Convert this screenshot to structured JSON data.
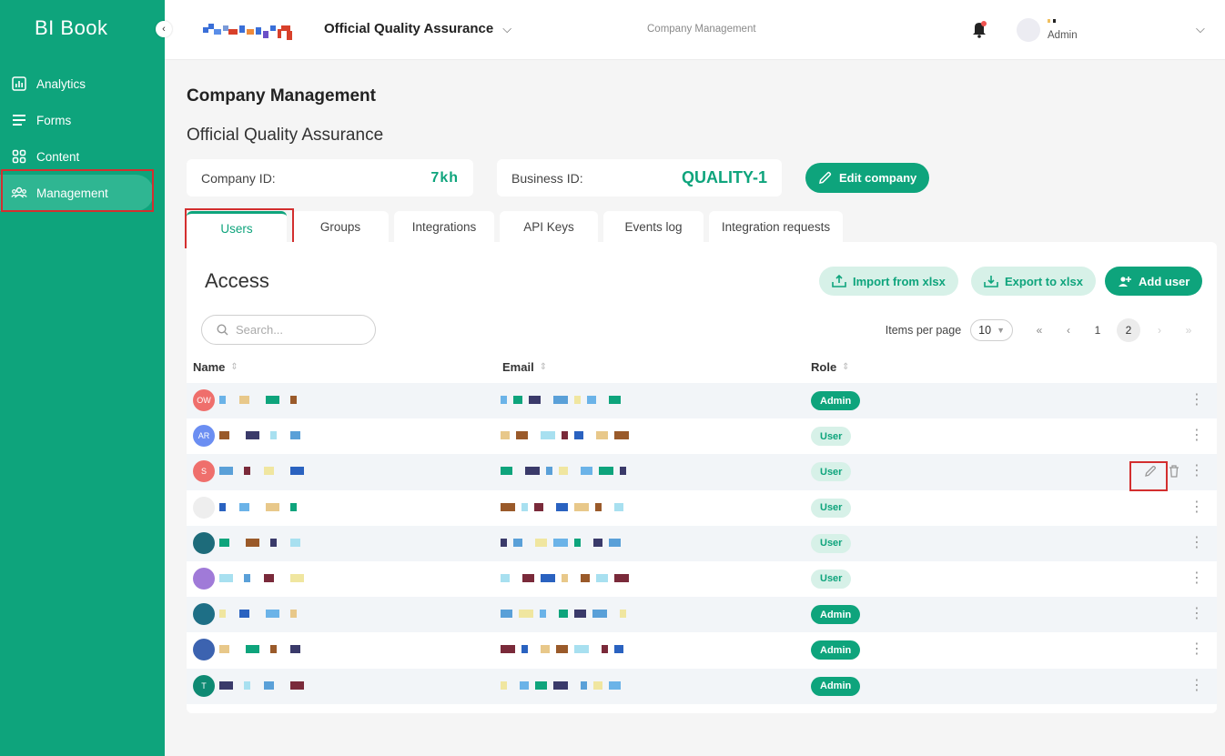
{
  "sidebar": {
    "logo": "BI Book",
    "items": [
      {
        "label": "Analytics",
        "icon": "bar-chart-icon"
      },
      {
        "label": "Forms",
        "icon": "list-icon"
      },
      {
        "label": "Content",
        "icon": "grid-icon"
      },
      {
        "label": "Management",
        "icon": "users-icon",
        "active": true
      }
    ]
  },
  "topbar": {
    "company": "Official Quality Assurance",
    "breadcrumb": "Company Management",
    "user_role": "Admin"
  },
  "header": {
    "title": "Company Management",
    "company_name": "Official Quality Assurance",
    "company_id_label": "Company ID:",
    "company_id_value": "7kh",
    "business_id_label": "Business ID:",
    "business_id_value": "QUALITY-1",
    "edit_label": "Edit company"
  },
  "tabs": [
    "Users",
    "Groups",
    "Integrations",
    "API Keys",
    "Events log",
    "Integration requests"
  ],
  "active_tab": "Users",
  "panel": {
    "title": "Access",
    "import_label": "Import from xlsx",
    "export_label": "Export to xlsx",
    "add_label": "Add user",
    "search_placeholder": "Search...",
    "items_per_page_label": "Items per page",
    "items_per_page": "10",
    "pages": [
      "1",
      "2"
    ],
    "current_page": "2"
  },
  "table": {
    "columns": [
      "Name",
      "Email",
      "Role"
    ],
    "rows": [
      {
        "initials": "OW",
        "avatar_color": "#ef6f6c",
        "role": "Admin"
      },
      {
        "initials": "AR",
        "avatar_color": "#6b8ef2",
        "role": "User"
      },
      {
        "initials": "S",
        "avatar_color": "#ef6f6c",
        "role": "User"
      },
      {
        "initials": "",
        "avatar_color": "#eeeeee",
        "role": "User"
      },
      {
        "initials": "",
        "avatar_color": "#1d6b7a",
        "role": "User"
      },
      {
        "initials": "",
        "avatar_color": "#a07ad8",
        "role": "User"
      },
      {
        "initials": "",
        "avatar_color": "#1e6f86",
        "role": "Admin"
      },
      {
        "initials": "",
        "avatar_color": "#3c63b0",
        "role": "Admin"
      },
      {
        "initials": "T",
        "avatar_color": "#0e8a73",
        "role": "Admin"
      }
    ]
  },
  "colors": {
    "accent": "#0ea47c",
    "accent_light": "#d7f1e8",
    "highlight": "#d32f2f"
  }
}
